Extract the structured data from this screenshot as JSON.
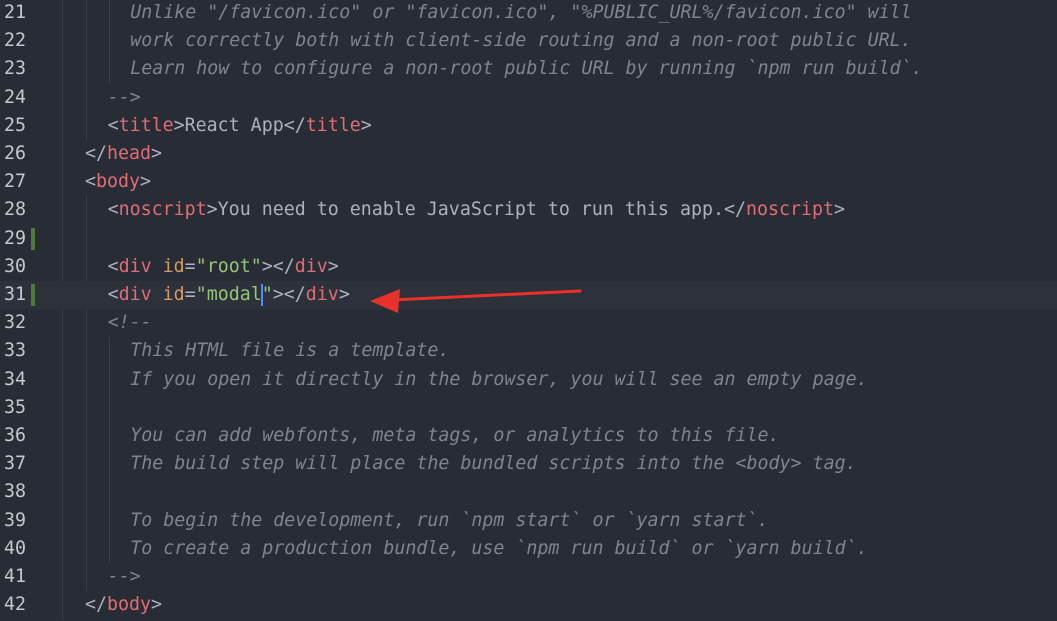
{
  "editor": {
    "colors": {
      "background": "#282c34",
      "active_line": "#2c313a",
      "tag": "#e06c75",
      "attribute": "#d19a66",
      "string": "#98c379",
      "comment": "#7f848e",
      "text": "#abb2bf",
      "modified_marker": "#4f7a3a",
      "annotation_arrow": "#e8312d"
    },
    "lines": [
      {
        "num": "21",
        "indent": 2,
        "tokens": [
          {
            "t": "cmt",
            "v": "Unlike \"/favicon.ico\" or \"favicon.ico\", \"%PUBLIC_URL%/favicon.ico\" will"
          }
        ]
      },
      {
        "num": "22",
        "indent": 2,
        "tokens": [
          {
            "t": "cmt",
            "v": "work correctly both with client-side routing and a non-root public URL."
          }
        ]
      },
      {
        "num": "23",
        "indent": 2,
        "tokens": [
          {
            "t": "cmt",
            "v": "Learn how to configure a non-root public URL by running `npm run build`."
          }
        ]
      },
      {
        "num": "24",
        "indent": 1,
        "tokens": [
          {
            "t": "cmt",
            "v": "-->"
          }
        ]
      },
      {
        "num": "25",
        "indent": 1,
        "tokens": [
          {
            "t": "txt",
            "v": "<"
          },
          {
            "t": "tag",
            "v": "title"
          },
          {
            "t": "txt",
            "v": ">React App</"
          },
          {
            "t": "tag",
            "v": "title"
          },
          {
            "t": "txt",
            "v": ">"
          }
        ]
      },
      {
        "num": "26",
        "indent": 0,
        "tokens": [
          {
            "t": "txt",
            "v": "</"
          },
          {
            "t": "tag",
            "v": "head"
          },
          {
            "t": "txt",
            "v": ">"
          }
        ]
      },
      {
        "num": "27",
        "indent": 0,
        "tokens": [
          {
            "t": "txt",
            "v": "<"
          },
          {
            "t": "tag",
            "v": "body"
          },
          {
            "t": "txt",
            "v": ">"
          }
        ]
      },
      {
        "num": "28",
        "indent": 1,
        "tokens": [
          {
            "t": "txt",
            "v": "<"
          },
          {
            "t": "tag",
            "v": "noscript"
          },
          {
            "t": "txt",
            "v": ">You need to enable JavaScript to run this app.</"
          },
          {
            "t": "tag",
            "v": "noscript"
          },
          {
            "t": "txt",
            "v": ">"
          }
        ]
      },
      {
        "num": "29",
        "indent": 0,
        "modified": true,
        "tokens": []
      },
      {
        "num": "30",
        "indent": 1,
        "tokens": [
          {
            "t": "txt",
            "v": "<"
          },
          {
            "t": "tag",
            "v": "div"
          },
          {
            "t": "txt",
            "v": " "
          },
          {
            "t": "attr",
            "v": "id"
          },
          {
            "t": "txt",
            "v": "="
          },
          {
            "t": "str",
            "v": "\"root\""
          },
          {
            "t": "txt",
            "v": "></"
          },
          {
            "t": "tag",
            "v": "div"
          },
          {
            "t": "txt",
            "v": ">"
          }
        ]
      },
      {
        "num": "31",
        "indent": 1,
        "modified": true,
        "active": true,
        "tokens": [
          {
            "t": "txt",
            "v": "<"
          },
          {
            "t": "tag",
            "v": "div"
          },
          {
            "t": "txt",
            "v": " "
          },
          {
            "t": "attr",
            "v": "id"
          },
          {
            "t": "txt",
            "v": "="
          },
          {
            "t": "str",
            "v": "\"modal"
          },
          {
            "t": "cursor",
            "v": ""
          },
          {
            "t": "str",
            "v": "\""
          },
          {
            "t": "txt",
            "v": "></"
          },
          {
            "t": "tag",
            "v": "div"
          },
          {
            "t": "txt",
            "v": ">"
          }
        ]
      },
      {
        "num": "32",
        "indent": 1,
        "tokens": [
          {
            "t": "cmt",
            "v": "<!--"
          }
        ]
      },
      {
        "num": "33",
        "indent": 2,
        "tokens": [
          {
            "t": "cmt",
            "v": "This HTML file is a template."
          }
        ]
      },
      {
        "num": "34",
        "indent": 2,
        "tokens": [
          {
            "t": "cmt",
            "v": "If you open it directly in the browser, you will see an empty page."
          }
        ]
      },
      {
        "num": "35",
        "indent": 0,
        "tokens": []
      },
      {
        "num": "36",
        "indent": 2,
        "tokens": [
          {
            "t": "cmt",
            "v": "You can add webfonts, meta tags, or analytics to this file."
          }
        ]
      },
      {
        "num": "37",
        "indent": 2,
        "tokens": [
          {
            "t": "cmt",
            "v": "The build step will place the bundled scripts into the <body> tag."
          }
        ]
      },
      {
        "num": "38",
        "indent": 0,
        "tokens": []
      },
      {
        "num": "39",
        "indent": 2,
        "tokens": [
          {
            "t": "cmt",
            "v": "To begin the development, run `npm start` or `yarn start`."
          }
        ]
      },
      {
        "num": "40",
        "indent": 2,
        "tokens": [
          {
            "t": "cmt",
            "v": "To create a production bundle, use `npm run build` or `yarn build`."
          }
        ]
      },
      {
        "num": "41",
        "indent": 1,
        "tokens": [
          {
            "t": "cmt",
            "v": "-->"
          }
        ]
      },
      {
        "num": "42",
        "indent": 0,
        "tokens": [
          {
            "t": "txt",
            "v": "</"
          },
          {
            "t": "tag",
            "v": "body"
          },
          {
            "t": "txt",
            "v": ">"
          }
        ]
      }
    ]
  }
}
